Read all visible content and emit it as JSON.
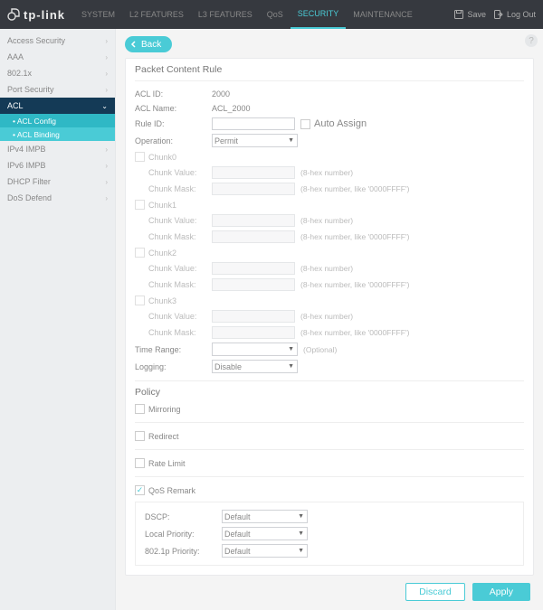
{
  "brand": "tp-link",
  "topnav": [
    "SYSTEM",
    "L2 FEATURES",
    "L3 FEATURES",
    "QoS",
    "SECURITY",
    "MAINTENANCE"
  ],
  "topnav_active": 4,
  "hdr_save": "Save",
  "hdr_logout": "Log Out",
  "side": {
    "items": [
      "Access Security",
      "AAA",
      "802.1x",
      "Port Security",
      "ACL",
      "IPv4 IMPB",
      "IPv6 IMPB",
      "DHCP Filter",
      "DoS Defend"
    ],
    "active_index": 4,
    "subs": [
      "ACL Config",
      "ACL Binding"
    ],
    "sub_active": 0
  },
  "back": "Back",
  "sections": {
    "rule_title": "Packet Content Rule",
    "policy_title": "Policy"
  },
  "fields": {
    "acl_id_lbl": "ACL ID:",
    "acl_id_val": "2000",
    "acl_name_lbl": "ACL Name:",
    "acl_name_val": "ACL_2000",
    "rule_id_lbl": "Rule ID:",
    "rule_id_val": "",
    "auto_assign": "Auto Assign",
    "operation_lbl": "Operation:",
    "operation_val": "Permit",
    "chunk_value_lbl": "Chunk Value:",
    "chunk_mask_lbl": "Chunk Mask:",
    "chunks": [
      "Chunk0",
      "Chunk1",
      "Chunk2",
      "Chunk3"
    ],
    "hint_value": "(8-hex number)",
    "hint_mask": "(8-hex number, like '0000FFFF')",
    "time_range_lbl": "Time Range:",
    "time_range_hint": "(Optional)",
    "logging_lbl": "Logging:",
    "logging_val": "Disable"
  },
  "policy": {
    "mirroring": "Mirroring",
    "redirect": "Redirect",
    "ratelimit": "Rate Limit",
    "qosremark": "QoS Remark",
    "qosremark_checked": true,
    "dscp_lbl": "DSCP:",
    "dscp_val": "Default",
    "localprio_lbl": "Local Priority:",
    "localprio_val": "Default",
    "dot1p_lbl": "802.1p Priority:",
    "dot1p_val": "Default"
  },
  "buttons": {
    "discard": "Discard",
    "apply": "Apply"
  }
}
